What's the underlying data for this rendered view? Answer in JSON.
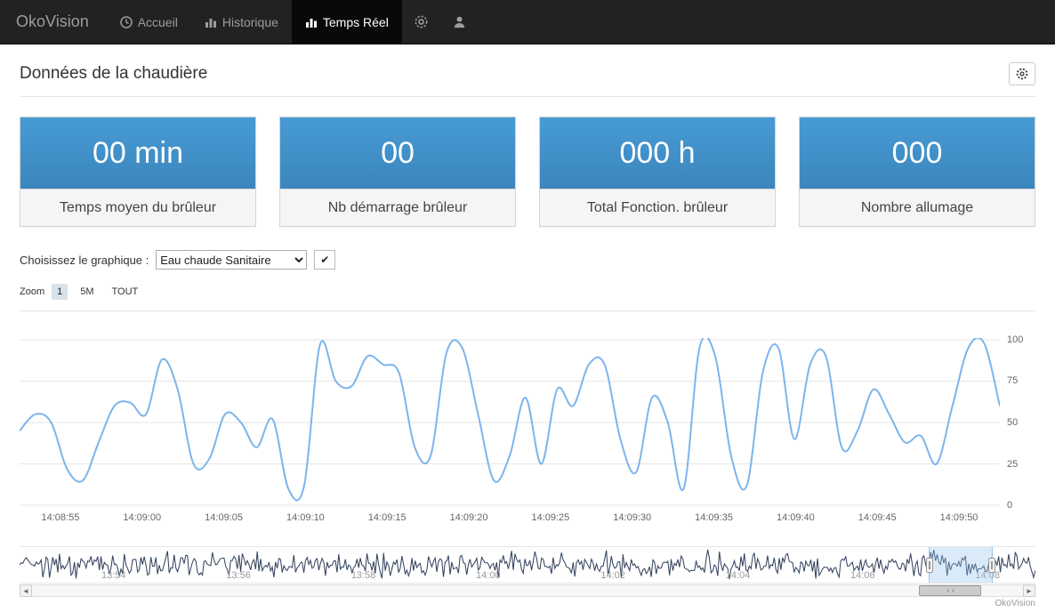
{
  "navbar": {
    "brand": "OkoVision",
    "items": [
      {
        "label": "Accueil",
        "icon": "clock-icon",
        "active": false
      },
      {
        "label": "Historique",
        "icon": "bar-chart-icon",
        "active": false
      },
      {
        "label": "Temps Réel",
        "icon": "bar-chart-icon",
        "active": true
      }
    ],
    "right_icons": [
      "gear-icon",
      "user-icon"
    ]
  },
  "page": {
    "title": "Données de la chaudière"
  },
  "cards": [
    {
      "value": "00 min",
      "label": "Temps moyen du brûleur"
    },
    {
      "value": "00",
      "label": "Nb démarrage brûleur"
    },
    {
      "value": "000 h",
      "label": "Total Fonction. brûleur"
    },
    {
      "value": "000",
      "label": "Nombre allumage"
    }
  ],
  "controls": {
    "chart_select_label": "Choisissez le graphique :",
    "chart_select_value": "Eau chaude Sanitaire",
    "check_glyph": "✔"
  },
  "zoom": {
    "label": "Zoom",
    "options": [
      {
        "label": "1",
        "active": true
      },
      {
        "label": "5M",
        "active": false
      },
      {
        "label": "TOUT",
        "active": false
      }
    ]
  },
  "chart_data": [
    {
      "type": "line",
      "series_name": "Eau chaude Sanitaire",
      "ylim": [
        0,
        100
      ],
      "yticks": [
        0,
        25,
        50,
        75,
        100
      ],
      "x_labels": [
        "14:08:55",
        "14:09:00",
        "14:09:05",
        "14:09:10",
        "14:09:15",
        "14:09:20",
        "14:09:25",
        "14:09:30",
        "14:09:35",
        "14:09:40",
        "14:09:45",
        "14:09:50"
      ],
      "values": [
        45,
        55,
        50,
        22,
        15,
        38,
        60,
        62,
        55,
        88,
        70,
        25,
        28,
        55,
        50,
        35,
        52,
        10,
        12,
        97,
        75,
        72,
        90,
        85,
        80,
        35,
        30,
        92,
        95,
        55,
        15,
        30,
        65,
        25,
        70,
        60,
        85,
        85,
        40,
        20,
        65,
        50,
        10,
        95,
        90,
        30,
        12,
        80,
        95,
        40,
        85,
        90,
        35,
        45,
        70,
        55,
        38,
        42,
        25,
        60,
        95,
        98,
        60
      ],
      "line_color": "#7cb5ec",
      "grid": true,
      "legend": "none",
      "yaxis_side": "right"
    },
    {
      "type": "line",
      "role": "navigator-overview",
      "x_labels": [
        "13:54",
        "13:56",
        "13:58",
        "14:00",
        "14:02",
        "14:04",
        "14:06",
        "14:08"
      ],
      "line_color": "#33425e",
      "selection": {
        "start_pct": 89.5,
        "end_pct": 95.8
      }
    }
  ],
  "scrollbar": {
    "left_arrow": "◄",
    "right_arrow": "►"
  },
  "footer": {
    "credit": "OkoVision"
  },
  "colors": {
    "accent": "#4191ca",
    "nav_bg": "#222222",
    "nav_active_bg": "#090909",
    "line": "#7cb5ec",
    "navigator_line": "#33425e"
  }
}
